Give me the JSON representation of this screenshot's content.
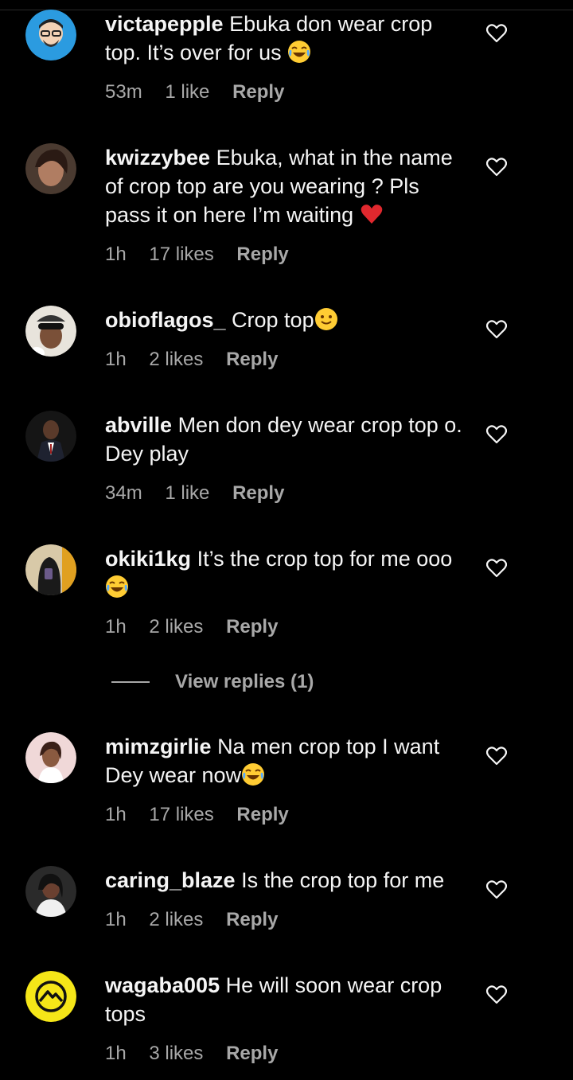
{
  "comments": [
    {
      "username": "victapepple",
      "text": "Ebuka don wear crop top. It’s over for us",
      "emoji": "laugh-cry",
      "time": "53m",
      "likes": "1 like",
      "reply": "Reply"
    },
    {
      "username": "kwizzybee",
      "text": "Ebuka, what in the name of crop top are you wearing ? Pls pass it on here I’m waiting",
      "emoji": "heart",
      "time": "1h",
      "likes": "17 likes",
      "reply": "Reply"
    },
    {
      "username": "obioflagos_",
      "text": "Crop top",
      "emoji": "smile",
      "time": "1h",
      "likes": "2 likes",
      "reply": "Reply"
    },
    {
      "username": "abville",
      "text": "Men don dey wear crop top o. Dey play",
      "emoji": "",
      "time": "34m",
      "likes": "1 like",
      "reply": "Reply"
    },
    {
      "username": "okiki1kg",
      "text": "It’s the crop top for me ooo",
      "emoji": "laugh-cry",
      "time": "1h",
      "likes": "2 likes",
      "reply": "Reply"
    },
    {
      "username": "mimzgirlie",
      "text": "Na men crop top I want Dey wear now",
      "emoji": "laugh-cry",
      "time": "1h",
      "likes": "17 likes",
      "reply": "Reply"
    },
    {
      "username": "caring_blaze",
      "text": "Is the crop top for me",
      "emoji": "",
      "time": "1h",
      "likes": "2 likes",
      "reply": "Reply"
    },
    {
      "username": "wagaba005",
      "text": "He will soon wear crop tops",
      "emoji": "",
      "time": "1h",
      "likes": "3 likes",
      "reply": "Reply"
    }
  ],
  "view_replies": "View replies (1)",
  "icons": {
    "like": "heart-outline-icon"
  },
  "colors": {
    "background": "#000000",
    "text": "#f5f5f5",
    "secondary": "#a8a8a8"
  }
}
